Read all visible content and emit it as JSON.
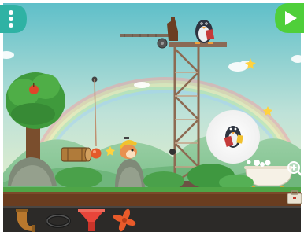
{
  "hud": {
    "menu_icon": "vertical-ellipsis-icon",
    "play_icon": "play-triangle-icon",
    "zoom_icon": "magnifier-plus-icon",
    "toolbox_icon": "toolbox-icon"
  },
  "scene": {
    "characters": [
      "penguin",
      "hedgehog-with-helmet"
    ],
    "thought_bubble": "penguin-reading"
  },
  "tray": {
    "parts": [
      {
        "name": "pipe-bend",
        "icon": "pipe-elbow-icon"
      },
      {
        "name": "rope",
        "icon": "rope-loop-icon"
      },
      {
        "name": "funnel",
        "icon": "funnel-icon"
      },
      {
        "name": "fan",
        "icon": "fan-icon"
      }
    ]
  },
  "colors": {
    "sky_top": "#5fbfc9",
    "sky_bottom": "#eaf1c9",
    "hud_green": "#4fcf3a",
    "hud_teal": "#2fb2a4",
    "ground": "#6a3d20",
    "tray": "#2c2a28",
    "fan": "#e85a2a"
  }
}
